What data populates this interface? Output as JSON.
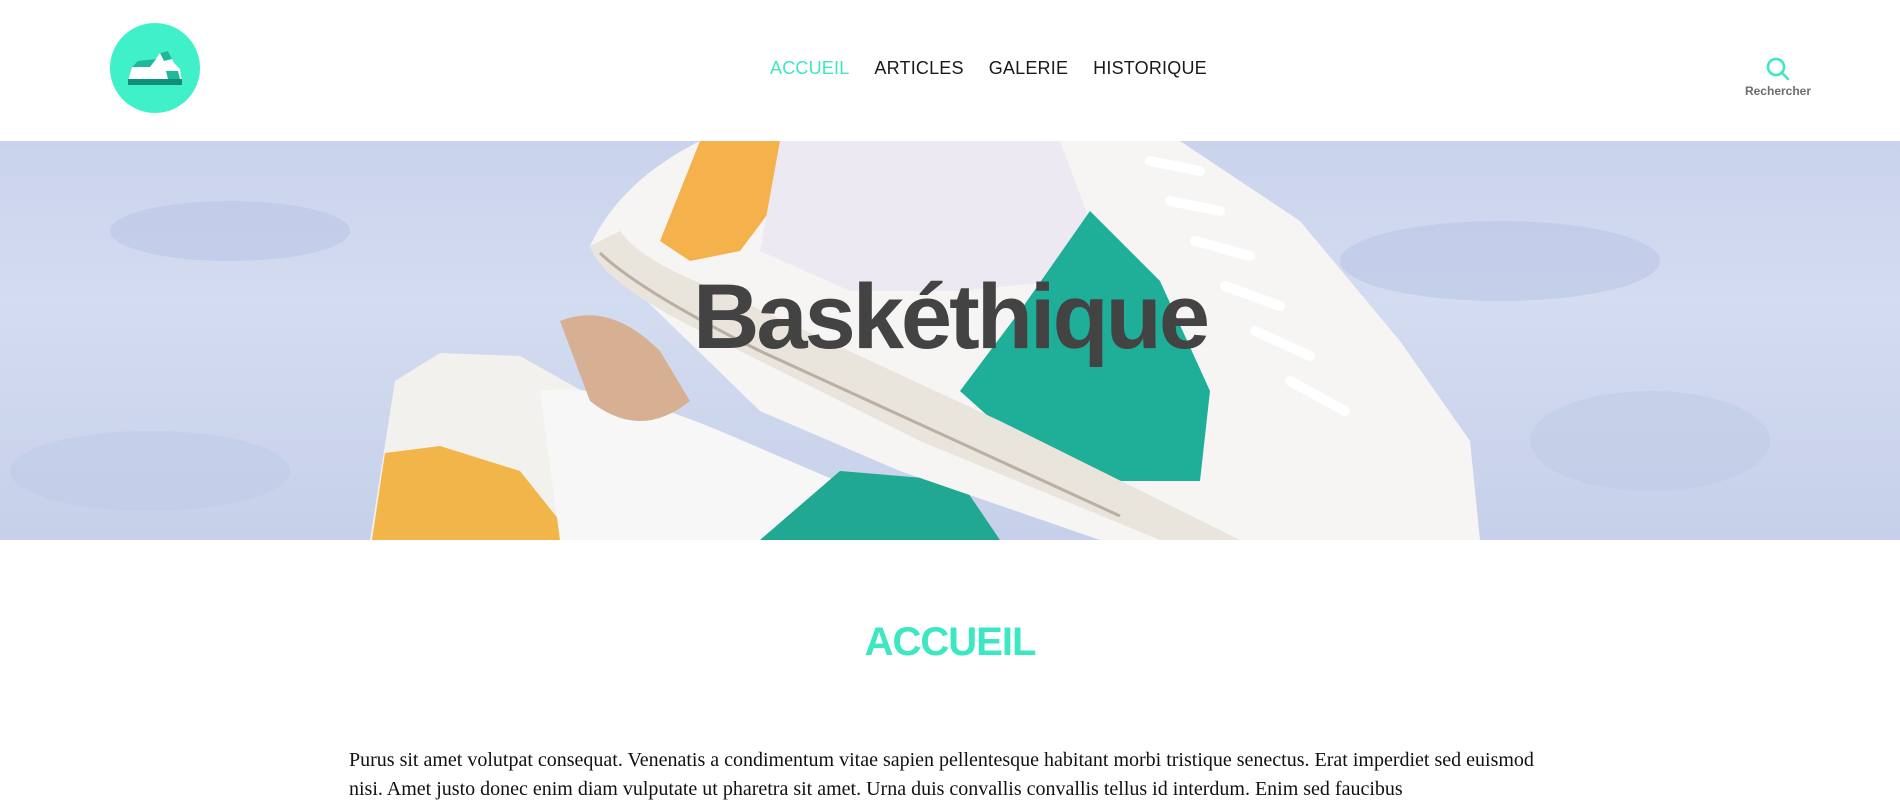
{
  "header": {
    "logo": {
      "icon": "sneaker-icon",
      "color": "#3ff0c8"
    },
    "nav": [
      {
        "label": "ACCUEIL",
        "active": true
      },
      {
        "label": "ARTICLES",
        "active": false
      },
      {
        "label": "GALERIE",
        "active": false
      },
      {
        "label": "HISTORIQUE",
        "active": false
      }
    ],
    "search": {
      "icon": "search-icon",
      "label": "Rechercher"
    }
  },
  "hero": {
    "title": "Baskéthique"
  },
  "main": {
    "heading": "ACCUEIL",
    "paragraph": "Purus sit amet volutpat consequat. Venenatis a condimentum vitae sapien pellentesque habitant morbi tristique senectus. Erat imperdiet sed euismod nisi. Amet justo donec enim diam vulputate ut pharetra sit amet. Urna duis convallis convallis tellus id interdum. Enim sed faucibus"
  },
  "colors": {
    "accent": "#3be8c2",
    "hero_title": "#434343",
    "text": "#111111"
  }
}
